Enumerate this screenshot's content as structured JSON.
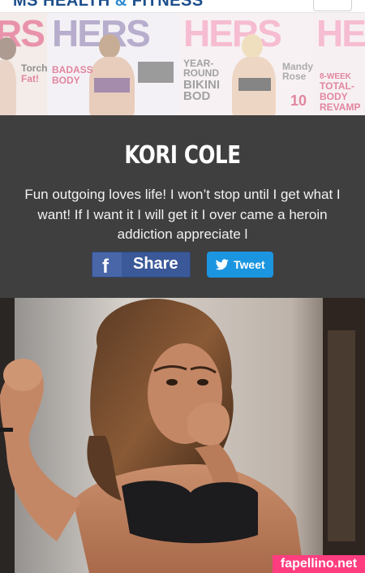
{
  "header": {
    "brand_main": "MS HEALTH ",
    "brand_amp": "& ",
    "brand_tail": "FITNESS",
    "menu_icon": "hamburger-icon"
  },
  "banner": {
    "covers": [
      {
        "mag": "RS",
        "lines": [
          "Torch",
          "Fat!"
        ]
      },
      {
        "mag": "HERS",
        "lines": [
          "BADASS",
          "BODY"
        ]
      },
      {
        "mag": "HERS",
        "lines": [
          "YEAR-",
          "ROUND",
          "BIKINI",
          "BOD"
        ]
      },
      {
        "mag": "HERS",
        "lines": [
          "Mandy",
          "Rose",
          "10"
        ]
      },
      {
        "mag": "HE",
        "lines": [
          "8-WEEK",
          "TOTAL-",
          "BODY",
          "REVAMP"
        ]
      }
    ]
  },
  "profile": {
    "name": "KORI COLE",
    "bio": "Fun outgoing loves life! I won’t stop until I get what I want! If I want it I will get it I over came a heroin addiction appreciate l"
  },
  "social": {
    "share_label": "Share",
    "share_icon": "facebook-icon",
    "tweet_label": "Tweet",
    "tweet_icon": "twitter-bird-icon"
  },
  "watermark": "fapellino.net"
}
